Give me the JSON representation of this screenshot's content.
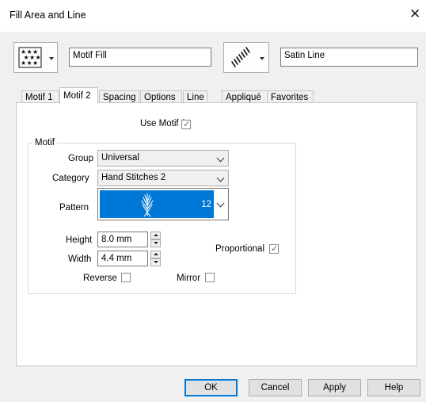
{
  "window": {
    "title": "Fill Area and Line",
    "close_glyph": "✕"
  },
  "toolbar": {
    "fill_icon": "star-motif-fill-icon",
    "fill_name": "Motif Fill",
    "line_icon": "satin-line-icon",
    "line_name": "Satin Line"
  },
  "tabs": [
    {
      "label": "Motif 1",
      "active": false
    },
    {
      "label": "Motif 2",
      "active": true
    },
    {
      "label": "Spacing",
      "active": false
    },
    {
      "label": "Options",
      "active": false
    },
    {
      "label": "Line",
      "active": false
    },
    {
      "label": "Appliqué",
      "active": false
    },
    {
      "label": "Favorites",
      "active": false
    }
  ],
  "motif2": {
    "use_motif2_label": "Use Motif 2",
    "use_motif2_checked": true,
    "group_title": "Motif",
    "group_label": "Group",
    "group_value": "Universal",
    "category_label": "Category",
    "category_value": "Hand Stitches 2",
    "pattern_label": "Pattern",
    "pattern_number": "12",
    "pattern_icon": "feather-stitch-icon",
    "pattern_bg": "#0078d7",
    "height_label": "Height",
    "height_value": "8.0 mm",
    "width_label": "Width",
    "width_value": "4.4 mm",
    "proportional_label": "Proportional",
    "proportional_checked": true,
    "reverse_label": "Reverse",
    "reverse_checked": false,
    "mirror_label": "Mirror",
    "mirror_checked": false
  },
  "buttons": {
    "ok": "OK",
    "cancel": "Cancel",
    "apply": "Apply",
    "help": "Help"
  }
}
